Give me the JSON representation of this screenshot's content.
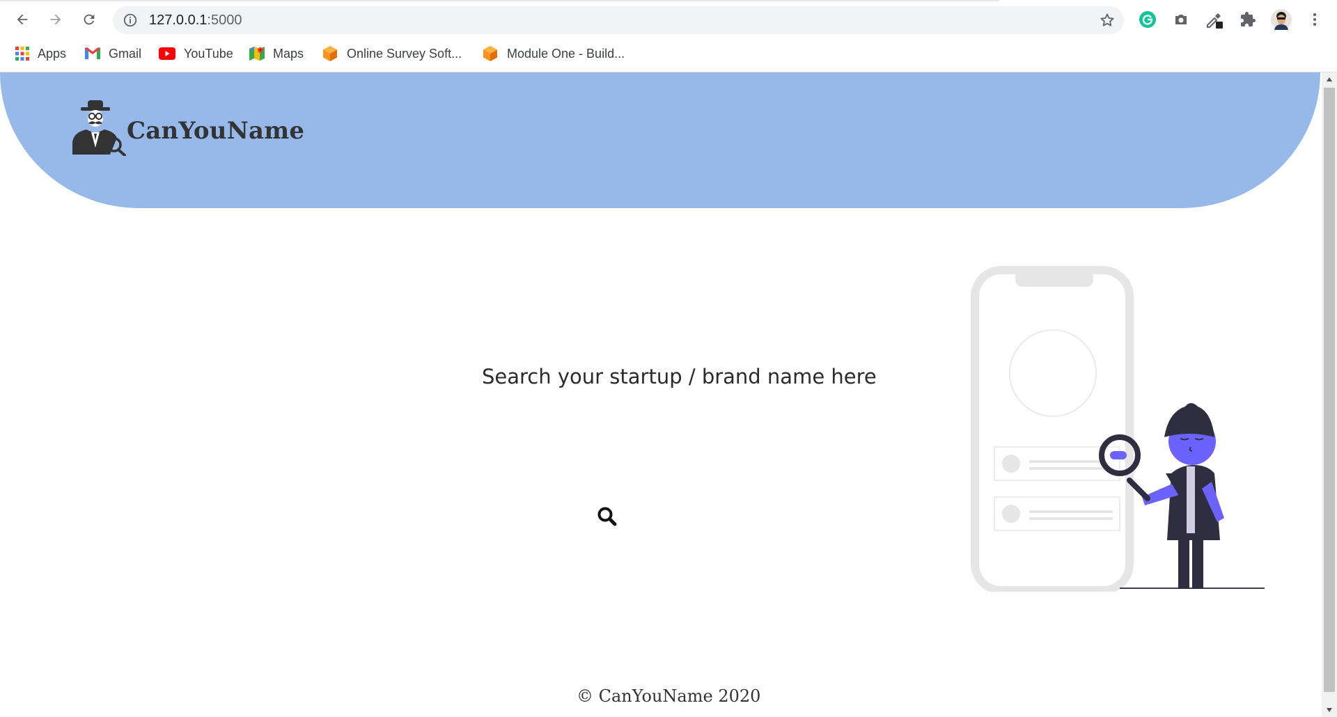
{
  "browser": {
    "url_host": "127.0.0.1",
    "url_port": ":5000",
    "bookmarks": [
      {
        "label": "Apps",
        "icon": "apps-grid-icon"
      },
      {
        "label": "Gmail",
        "icon": "gmail-icon"
      },
      {
        "label": "YouTube",
        "icon": "youtube-icon"
      },
      {
        "label": "Maps",
        "icon": "maps-icon"
      },
      {
        "label": "Online Survey Soft...",
        "icon": "orange-cube-icon"
      },
      {
        "label": "Module One - Build...",
        "icon": "orange-cube-icon"
      }
    ]
  },
  "site": {
    "brand": "CanYouName",
    "search_prompt": "Search your startup / brand name here",
    "footer": "© CanYouName 2020"
  },
  "colors": {
    "hero": "#96b9ea",
    "accent_purple": "#6c63ff",
    "dark": "#2f2e41",
    "phone": "#e6e6e6"
  }
}
